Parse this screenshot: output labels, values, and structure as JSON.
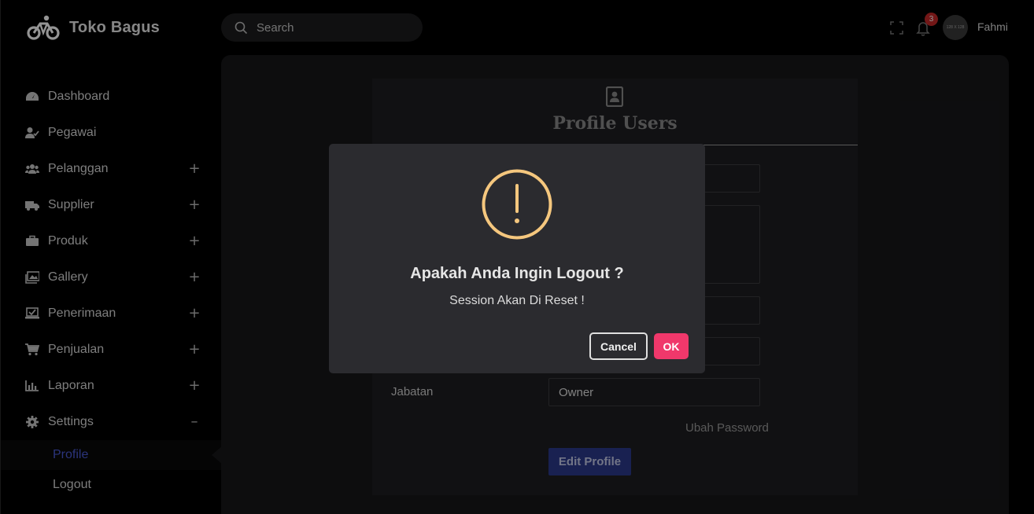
{
  "brand": {
    "name": "Toko Bagus",
    "icon": "motorbike-icon"
  },
  "search": {
    "placeholder": "Search"
  },
  "topbar": {
    "notification_count": "3",
    "avatar_text": "128 X 128",
    "username": "Fahmi"
  },
  "sidebar": {
    "items": [
      {
        "label": "Dashboard",
        "icon": "dashboard-icon",
        "toggle": ""
      },
      {
        "label": "Pegawai",
        "icon": "user-check-icon",
        "toggle": ""
      },
      {
        "label": "Pelanggan",
        "icon": "users-icon",
        "toggle": "+"
      },
      {
        "label": "Supplier",
        "icon": "truck-icon",
        "toggle": "+"
      },
      {
        "label": "Produk",
        "icon": "briefcase-icon",
        "toggle": "+"
      },
      {
        "label": "Gallery",
        "icon": "images-icon",
        "toggle": "+"
      },
      {
        "label": "Penerimaan",
        "icon": "laptop-check-icon",
        "toggle": "+"
      },
      {
        "label": "Penjualan",
        "icon": "cart-icon",
        "toggle": "+"
      },
      {
        "label": "Laporan",
        "icon": "chart-icon",
        "toggle": "+"
      },
      {
        "label": "Settings",
        "icon": "gear-icon",
        "toggle": "–"
      }
    ],
    "submenu": [
      {
        "label": "Profile",
        "active": true
      },
      {
        "label": "Logout",
        "active": false
      }
    ]
  },
  "profile": {
    "title": "Profile Users",
    "jabatan_label": "Jabatan",
    "jabatan_value": "Owner",
    "change_password_link": "Ubah Password",
    "edit_button": "Edit Profile"
  },
  "modal": {
    "title": "Apakah Anda Ingin Logout ?",
    "text": "Session Akan Di Reset !",
    "cancel": "Cancel",
    "ok": "OK",
    "icon": "warning-icon"
  },
  "colors": {
    "accent": "#4a5bd6",
    "ok": "#f0386b",
    "warning": "#f5c77e",
    "badge": "#c62828"
  }
}
